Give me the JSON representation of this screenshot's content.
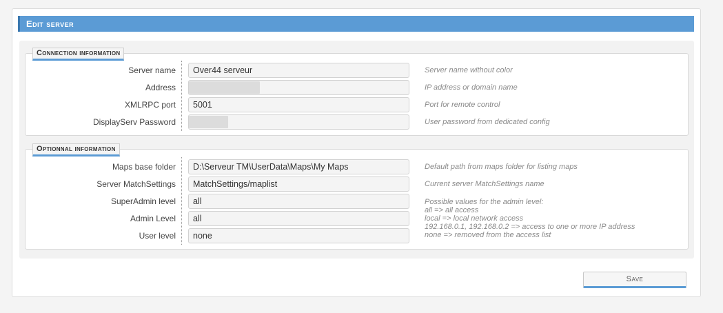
{
  "header": {
    "title": "Edit server"
  },
  "connection": {
    "legend": "Connection information",
    "rows": [
      {
        "label": "Server name",
        "value": "Over44 serveur",
        "help": "Server name without color"
      },
      {
        "label": "Address",
        "value": "",
        "help": "IP address or domain name"
      },
      {
        "label": "XMLRPC port",
        "value": "5001",
        "help": "Port for remote control"
      },
      {
        "label": "DisplayServ Password",
        "value": "",
        "help": "User password from dedicated config"
      }
    ]
  },
  "optional": {
    "legend": "Optionnal information",
    "rows": [
      {
        "label": "Maps base folder",
        "value": "D:\\Serveur TM\\UserData\\Maps\\My Maps",
        "help": "Default path from maps folder for listing maps"
      },
      {
        "label": "Server MatchSettings",
        "value": "MatchSettings/maplist",
        "help": "Current server MatchSettings name"
      },
      {
        "label": "SuperAdmin level",
        "value": "all"
      },
      {
        "label": "Admin Level",
        "value": "all"
      },
      {
        "label": "User level",
        "value": "none"
      }
    ],
    "level_help": [
      "Possible values for the admin level:",
      "all => all access",
      "local => local network access",
      "192.168.0.1, 192.168.0.2 => access to one or more IP address",
      "none => removed from the access list"
    ]
  },
  "actions": {
    "save_label": "Save"
  }
}
